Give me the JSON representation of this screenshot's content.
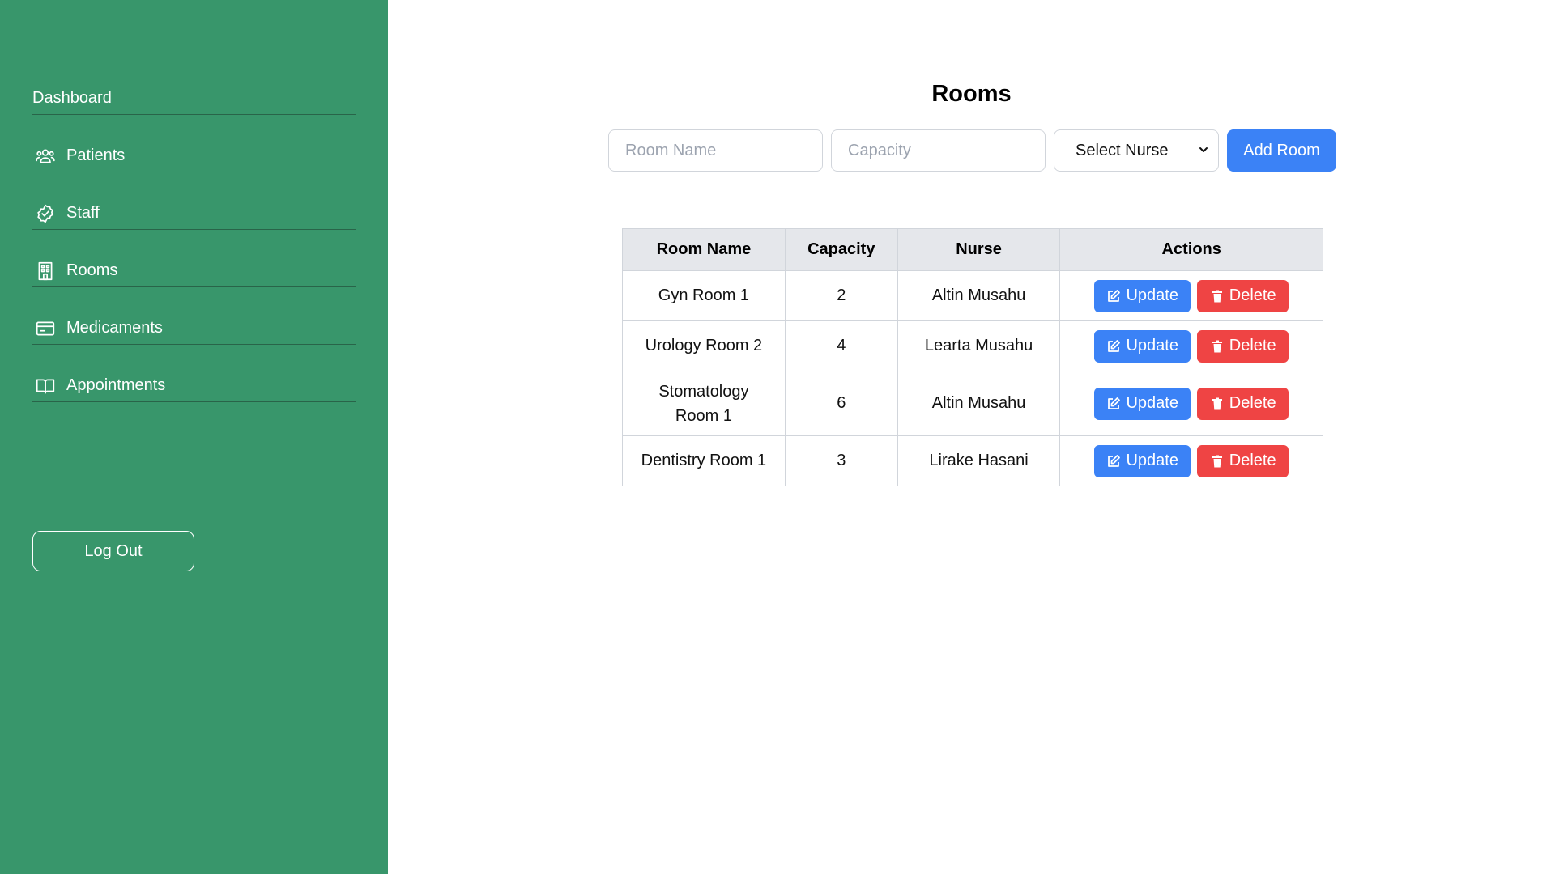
{
  "sidebar": {
    "items": [
      {
        "label": "Dashboard",
        "icon": "none"
      },
      {
        "label": "Patients",
        "icon": "users-icon"
      },
      {
        "label": "Staff",
        "icon": "badge-check-icon"
      },
      {
        "label": "Rooms",
        "icon": "building-icon"
      },
      {
        "label": "Medicaments",
        "icon": "card-icon"
      },
      {
        "label": "Appointments",
        "icon": "book-open-icon"
      }
    ],
    "logout_label": "Log Out",
    "background": "#38966b"
  },
  "main": {
    "title": "Rooms",
    "form": {
      "room_name_placeholder": "Room Name",
      "capacity_placeholder": "Capacity",
      "nurse_select_value": "Select Nurse",
      "add_button_label": "Add Room"
    },
    "table": {
      "headers": [
        "Room Name",
        "Capacity",
        "Nurse",
        "Actions"
      ],
      "rows": [
        {
          "name": "Gyn Room 1",
          "capacity": "2",
          "nurse": "Altin Musahu"
        },
        {
          "name": "Urology Room 2",
          "capacity": "4",
          "nurse": "Learta Musahu"
        },
        {
          "name": "Stomatology Room 1",
          "capacity": "6",
          "nurse": "Altin Musahu"
        },
        {
          "name": "Dentistry Room 1",
          "capacity": "3",
          "nurse": "Lirake Hasani"
        }
      ],
      "update_label": "Update",
      "delete_label": "Delete"
    }
  },
  "colors": {
    "accent_blue": "#3b82f6",
    "danger_red": "#ef4444"
  }
}
